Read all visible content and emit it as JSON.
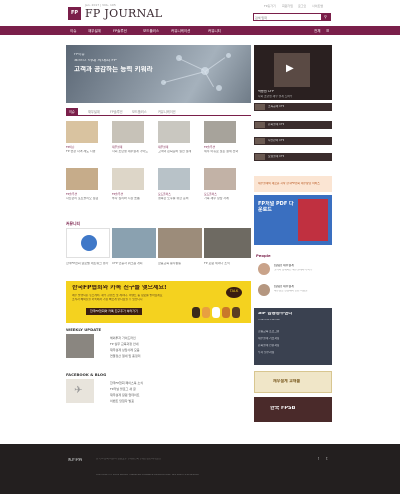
{
  "header": {
    "logo_mark": "FP",
    "brand": "FP JOURNAL",
    "issue": "Jan. 2017 | VOL. 105",
    "util_links": [
      "FP홈가기",
      "회원가입",
      "로그인",
      "사이트맵"
    ],
    "search_placeholder": "검색 입력"
  },
  "nav": {
    "items": [
      "이슈",
      "재무설계",
      "FP솔루션",
      "모드플러스",
      "커뮤니케이션",
      "커뮤니티"
    ],
    "all_menu": "전체"
  },
  "hero": {
    "kicker": "FP이슈",
    "subtitle": "포브스 미래 시대의 FP",
    "title": "고객과 공감하는 능력 키워라"
  },
  "tabs": {
    "items": [
      "이슈",
      "재무설계",
      "FP솔루션",
      "모드플러스",
      "커뮤니케이션"
    ]
  },
  "articles": [
    {
      "cat": "FP이슈",
      "caption": "FP 현장 자격 제도 시행"
    },
    {
      "cat": "재무설계",
      "caption": "사회 초년생 재무설계 가이드"
    },
    {
      "cat": "재무설계",
      "caption": "고객의 은퇴준비 실전 설계"
    },
    {
      "cat": "FP솔루션",
      "caption": "세무 이슈로 보는 절세 전략"
    },
    {
      "cat": "FP솔루션",
      "caption": "자산관리 포트폴리오 점검"
    },
    {
      "cat": "FP솔루션",
      "caption": "투자 심리와 시장 흐름"
    },
    {
      "cat": "모드플러스",
      "caption": "행복한 노후를 위한 준비"
    },
    {
      "cat": "모드플러스",
      "caption": "가족 재무 상담 사례"
    }
  ],
  "community": {
    "title": "커뮤니티",
    "items": [
      {
        "caption": "한국FP협회 글로벌 네트워크 행사"
      },
      {
        "caption": "CFP 인증자 워크숍 개최"
      },
      {
        "caption": "금융교육 봉사활동"
      },
      {
        "caption": "FP 포럼 세미나 소식"
      }
    ]
  },
  "banner": {
    "title": "한국FP협회와 카톡 친구를 맺으세요!",
    "line1": "매주 발행되는 뉴스레터, 재무 콘텐츠 및 세미나, 이벤트 등 정보를 받아보세요",
    "line2": "소식과 혜택들을 카톡에서 가장 빠르게 만나보실 수 있습니다",
    "cta": "한국FP협회와 카톡 친구추가 하러가기",
    "badge": "TALK"
  },
  "weekly": {
    "title": "WEEKLY UPDATE",
    "rows": [
      "해외투자 가이드라인",
      "FP 실무 교육과정 안내",
      "재무설계 상담사례 모음",
      "연말정산 절세 팁 총정리"
    ]
  },
  "facebook": {
    "title": "FACEBOOK & BLOG",
    "rows": [
      "한국FP협회 페이스북 소식",
      "FP저널 블로그 새 글",
      "재무설계 칼럼 업데이트",
      "이벤트 당첨자 발표"
    ]
  },
  "sidebar": {
    "video_title": "박종원 CFP",
    "video_caption": "사회 초년생 재무 설계 노하우",
    "playlist": [
      "소득공제 CFP",
      "은퇴설계 CFP",
      "자산관리 CFP",
      "보험설계 CFP"
    ],
    "orange_text": "재무설계의 새로운 시작 한국FP협회 재무상담 서비스",
    "ad_title": "FP저널 PDF 다운로드",
    "people_title": "People",
    "people": [
      {
        "name": "[칼럼] 재무설계",
        "desc": "고객과 함께하는 재무설계사의 하루"
      },
      {
        "name": "[칼럼] 재무설계",
        "desc": "재무상담 현장에서 만난 사람들"
      }
    ],
    "sif_title": "SIF 금융공부센터",
    "sif_sub": "Financial Planner",
    "sif_rows": [
      "금융교육 프로그램",
      "재무설계 기초과정",
      "은퇴설계 전문과정",
      "투자 실무과정"
    ],
    "gold_text": "재무설계 교재몰",
    "fpsb_text": "한국 FPSB"
  },
  "footer": {
    "logo": "KFPA",
    "line1": "한국FP협회 서울시 영등포구 | 대표전화 | 개인정보처리방침",
    "copyright": "COPYRIGHT© 2016 KOREA FINANCIAL PLANNER ASSOCIATION. ALL RIGHTS RESERVED"
  },
  "colors": {
    "brand": "#7a1f4a",
    "banner": "#f4d21f",
    "footer": "#231f1f"
  }
}
